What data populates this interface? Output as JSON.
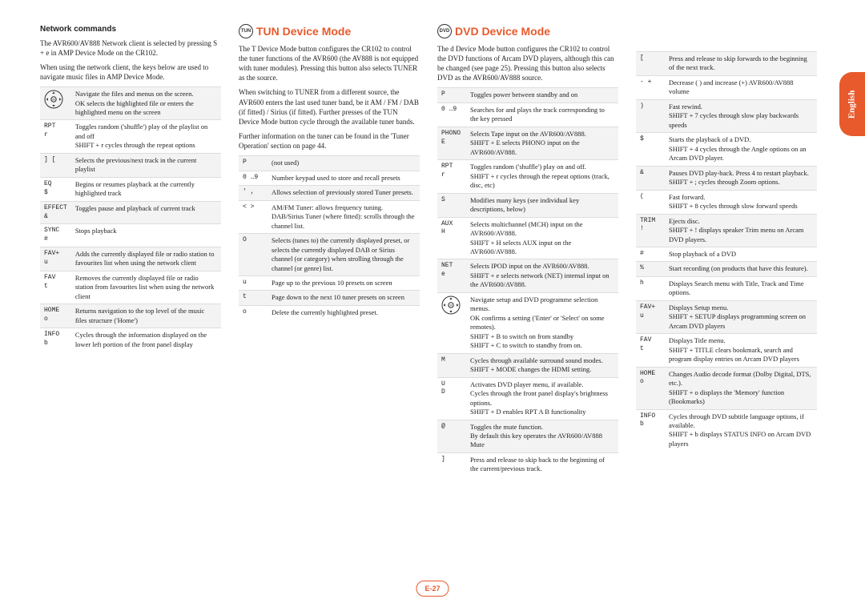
{
  "lang_tab": "English",
  "page_number": "E-27",
  "col1": {
    "heading": "Network commands",
    "para1_a": "The AVR600/AV888 Network client is selected by pressing ",
    "para1_key1": "S",
    "para1_mid": " + ",
    "para1_key2": "e",
    "para1_b": " in AMP Device Mode on the CR102.",
    "para2": "When using the network client, the keys below are used to navigate music files in AMP Device Mode.",
    "rows": [
      {
        "key": "NAVICON",
        "desc": "Navigate the files and menus on the screen.\nOK selects the highlighted file or enters the highlighted menu on the screen"
      },
      {
        "key": "RPT\nr",
        "desc": "Toggles random ('shuffle') play of the playlist on and off\nSHIFT + r  cycles through the repeat options"
      },
      {
        "key": "] [",
        "desc": "Selects the previous/next track in the current playlist"
      },
      {
        "key": "EQ\n$",
        "desc": "Begins or resumes playback at the currently highlighted track"
      },
      {
        "key": "EFFECT\n&",
        "desc": "Toggles pause and playback of current track"
      },
      {
        "key": "SYNC\n#",
        "desc": "Stops playback"
      },
      {
        "key": "FAV+\nu",
        "desc": "Adds the currently displayed file or radio station to favourites list when using the network client"
      },
      {
        "key": "FAV\nt",
        "desc": "Removes the currently displayed file or radio station from favourites list when using the network client"
      },
      {
        "key": "HOME\no",
        "desc": "Returns navigation to the top level of the music files structure ('Home')"
      },
      {
        "key": "INFO\nb",
        "desc": "Cycles through the information displayed on the lower left portion of the front panel display"
      }
    ]
  },
  "col2": {
    "heading": "TUN Device Mode",
    "circle": "TUN",
    "para1": "The T Device Mode button configures the CR102 to control the tuner functions of the AVR600 (the AV888 is not equipped with tuner modules). Pressing this button also selects TUNER as the source.",
    "para2": "When switching to TUNER from a different source, the AVR600 enters the last used tuner band, be it AM / FM / DAB (if fitted) / Sirius (if fitted). Further presses of the TUN Device Mode button cycle through the available tuner bands.",
    "para3": "Further information on the tuner can be found in the 'Tuner Operation' section on page 44.",
    "rows": [
      {
        "key": "P",
        "desc": "(not used)"
      },
      {
        "key": "0 …9",
        "desc": "Number keypad used to store and recall presets"
      },
      {
        "key": "' ,",
        "desc": "Allows selection of previously stored Tuner presets."
      },
      {
        "key": "< >",
        "desc": "AM/FM Tuner: allows frequency tuning.\nDAB/Sirius Tuner (where fitted): scrolls through the channel list."
      },
      {
        "key": "O",
        "desc": "Selects (tunes to) the currently displayed preset, or selects the currently displayed DAB or Sirius channel (or category) when strolling through the channel (or genre) list."
      },
      {
        "key": "u",
        "desc": "Page up to the previous 10 presets on screen"
      },
      {
        "key": "t",
        "desc": "Page down to the next 10 tuner presets on screen"
      },
      {
        "key": "o",
        "desc": "Delete the currently highlighted preset."
      }
    ]
  },
  "col3": {
    "heading": "DVD Device Mode",
    "circle": "DVD",
    "para1": "The d Device Mode button configures the CR102 to control the DVD functions of Arcam DVD players, although this can be changed (see page 25). Pressing this button also selects DVD as the AVR600/AV888 source.",
    "rows": [
      {
        "key": "P",
        "desc": "Toggles power between standby and on"
      },
      {
        "key": "0 …9",
        "desc": "Searches for and plays the track corresponding to the key pressed"
      },
      {
        "key": "PHONO\nE",
        "desc": "Selects Tape input on the AVR600/AV888.\nSHIFT + E  selects PHONO input on the AVR600/AV888."
      },
      {
        "key": "RPT\nr",
        "desc": "Toggles random ('shuffle') play on and off.\nSHIFT + r  cycles through the repeat options (track, disc, etc)"
      },
      {
        "key": "S",
        "desc": "Modifies many keys (see individual key descriptions, below)"
      },
      {
        "key": "AUX\nH",
        "desc": "Selects multichannel (MCH) input on the AVR600/AV888.\nSHIFT + H  selects AUX input on the AVR600/AV888."
      },
      {
        "key": "NET\ne",
        "desc": "Selects IPOD input on the AVR600/AV888.\nSHIFT + e  selects network (NET) internal input on the AVR600/AV888."
      },
      {
        "key": "NAVICON",
        "desc": "Navigate setup and DVD programme selection menus.\nOK confirms a setting ('Enter' or 'Select' on some remotes).\nSHIFT + B  to switch on from standby\nSHIFT + C  to switch to standby from on."
      },
      {
        "key": "M",
        "desc": "Cycles through available surround sound modes.\nSHIFT + MODE changes the HDMI setting."
      },
      {
        "key": "U\nD",
        "desc": "Activates DVD player menu, if available.\nCycles through the front panel display's brightness options.\nSHIFT + D  enables RPT A B functionality"
      },
      {
        "key": "@",
        "desc": "Toggles the mute function.\nBy default this key operates the AVR600/AV888 Mute"
      },
      {
        "key": "]",
        "desc": "Press and release to skip back to the beginning of the current/previous track."
      }
    ]
  },
  "col4": {
    "rows": [
      {
        "key": "[",
        "desc": "Press and release to skip forwards to the beginning of the next track."
      },
      {
        "key": "- +",
        "desc": "Decrease ( ) and increase (+) AVR600/AV888 volume"
      },
      {
        "key": ")",
        "desc": "Fast rewind.\nSHIFT + 7  cycles through slow play backwards speeds"
      },
      {
        "key": "$",
        "desc": "Starts the playback of a DVD.\nSHIFT + 4  cycles through the Angle options on an Arcam DVD player."
      },
      {
        "key": "&",
        "desc": "Pauses DVD play-back. Press 4 to restart playback.\nSHIFT + ;  cycles through Zoom options."
      },
      {
        "key": "(",
        "desc": "Fast forward.\nSHIFT + 8  cycles through slow forward speeds"
      },
      {
        "key": "TRIM\n!",
        "desc": "Ejects disc.\nSHIFT + !  displays speaker Trim menu on Arcam DVD players."
      },
      {
        "key": "#",
        "desc": "Stop playback of a DVD"
      },
      {
        "key": "%",
        "desc": "Start recording (on products that have this feature)."
      },
      {
        "key": "h",
        "desc": "Displays Search menu with Title, Track and Time options."
      },
      {
        "key": "FAV+\nu",
        "desc": "Displays Setup menu.\nSHIFT + SETUP displays programming screen on Arcam DVD players"
      },
      {
        "key": "FAV\nt",
        "desc": "Displays Title menu.\nSHIFT + TITLE clears bookmark, search and program display entries on Arcam DVD players"
      },
      {
        "key": "HOME\no",
        "desc": "Changes Audio decode format (Dolby Digital, DTS, etc.).\nSHIFT + o  displays the 'Memory' function (Bookmarks)"
      },
      {
        "key": "INFO\nb",
        "desc": "Cycles through DVD subtitle language options, if available.\nSHIFT + b  displays STATUS INFO on Arcam DVD players"
      }
    ]
  }
}
